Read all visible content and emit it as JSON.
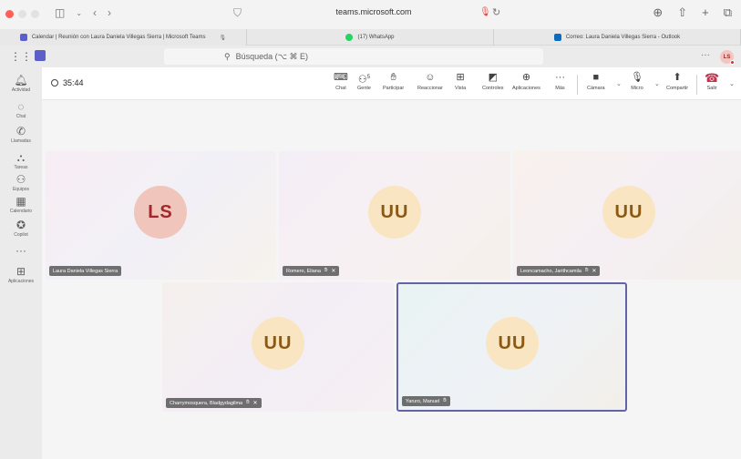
{
  "browser": {
    "url": "teams.microsoft.com",
    "tabs": [
      {
        "label": "Calendar | Reunión con Laura Daniela Villegas Sierra | Microsoft Teams",
        "icon_color": "#5b5fc7"
      },
      {
        "label": "(17) WhatsApp",
        "icon_color": "#25d366"
      },
      {
        "label": "Correo: Laura Daniela Villegas Sierra - Outlook",
        "icon_color": "#0f6cbd"
      }
    ]
  },
  "teams_header": {
    "search_placeholder": "Búsqueda (⌥ ⌘ E)",
    "user_initials": "LS"
  },
  "rail": [
    {
      "label": "Actividad",
      "icon": "bell-icon"
    },
    {
      "label": "Chat",
      "icon": "chat-icon"
    },
    {
      "label": "Llamadas",
      "icon": "phone-icon"
    },
    {
      "label": "Tareas",
      "icon": "tasks-icon"
    },
    {
      "label": "Equipos",
      "icon": "teams-icon"
    },
    {
      "label": "Calendario",
      "icon": "calendar-icon"
    },
    {
      "label": "Copilot",
      "icon": "copilot-icon"
    },
    {
      "label": "",
      "icon": "more-icon"
    },
    {
      "label": "Aplicaciones",
      "icon": "apps-icon"
    }
  ],
  "meeting": {
    "timer": "35:44",
    "people_count": "5",
    "toolbar": [
      {
        "label": "Chat",
        "icon": "chat-icon"
      },
      {
        "label": "Gente",
        "icon": "people-icon"
      },
      {
        "label": "Participar",
        "icon": "raise-hand-icon"
      },
      {
        "label": "Reaccionar",
        "icon": "emoji-icon"
      },
      {
        "label": "Vista",
        "icon": "view-icon"
      },
      {
        "label": "Controles",
        "icon": "controls-icon"
      },
      {
        "label": "Aplicaciones",
        "icon": "apps-icon"
      },
      {
        "label": "Más",
        "icon": "more-icon"
      },
      {
        "label": "Cámara",
        "icon": "camera-off-icon"
      },
      {
        "label": "Micro",
        "icon": "mic-icon"
      },
      {
        "label": "Compartir",
        "icon": "share-icon"
      },
      {
        "label": "Salir",
        "icon": "hangup-icon"
      }
    ],
    "participants": [
      {
        "initials": "LS",
        "name": "Laura Daniela Villegas Sierra",
        "mic_muted": false
      },
      {
        "initials": "UU",
        "name": "Romero, Eliana",
        "mic_muted": true
      },
      {
        "initials": "UU",
        "name": "Leoncamacho, Jarithcamila",
        "mic_muted": true
      },
      {
        "initials": "UU",
        "name": "Charrymosquera, Bladgydagilma",
        "mic_muted": true
      },
      {
        "initials": "UU",
        "name": "Yaruro, Manuel",
        "mic_muted": false,
        "speaking": true
      }
    ]
  },
  "colors": {
    "accent": "#5b5fc7",
    "hangup": "#c4314b",
    "speaking_border": "#6264a7"
  }
}
